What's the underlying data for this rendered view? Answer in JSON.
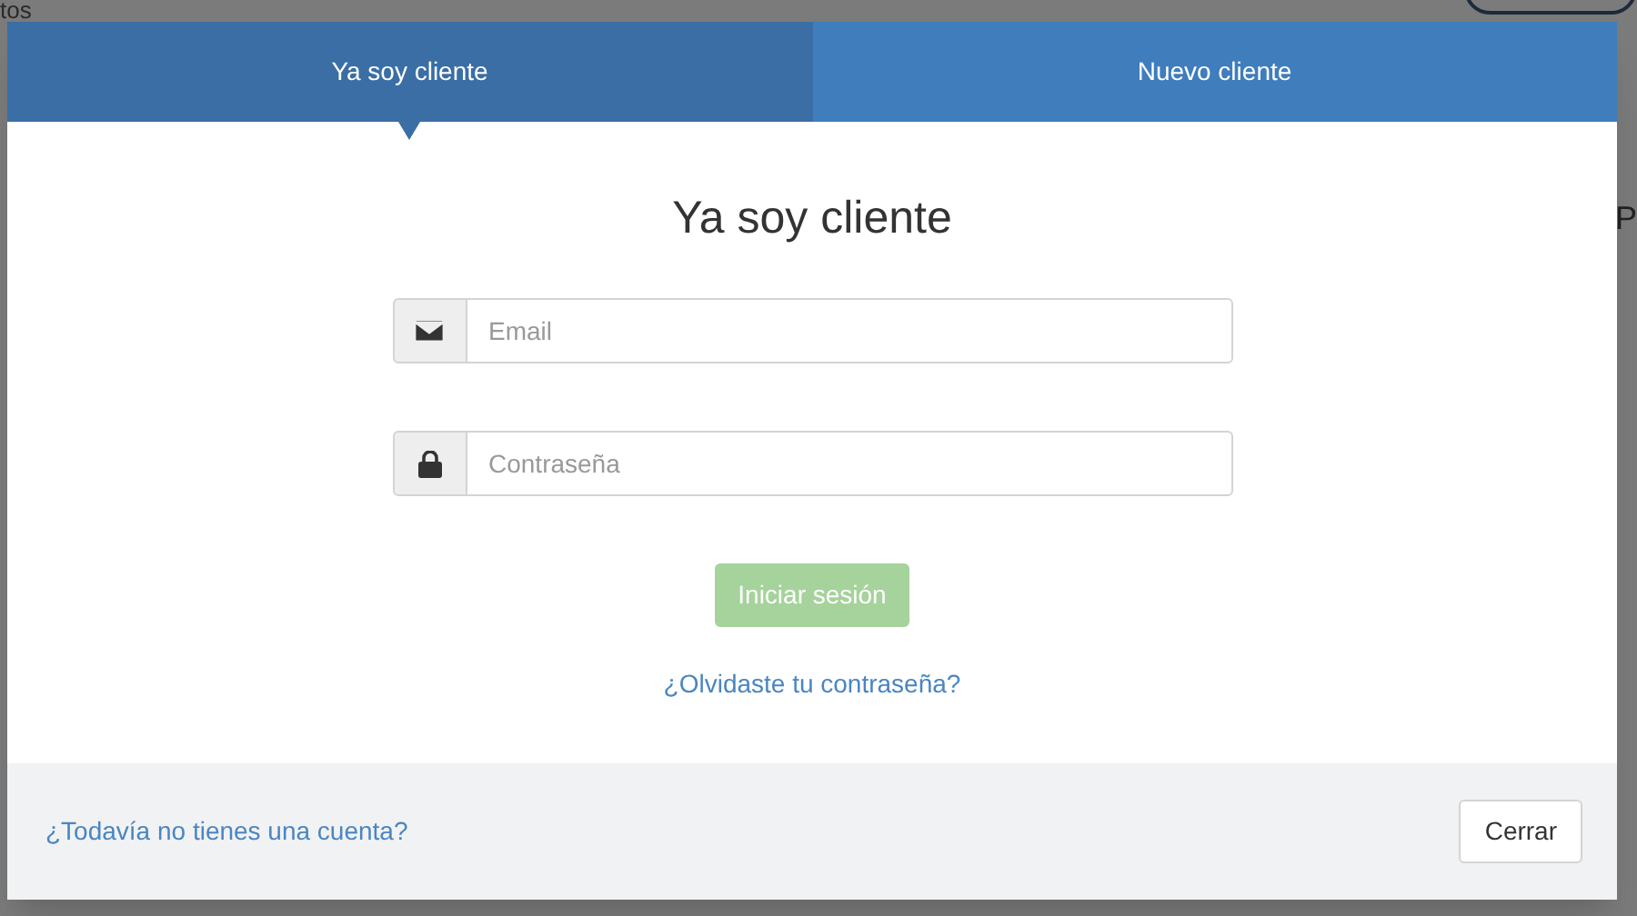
{
  "background": {
    "heading": "tos",
    "column_label": "P"
  },
  "tabs": [
    {
      "label": "Ya soy cliente",
      "selected": true
    },
    {
      "label": "Nuevo cliente",
      "selected": false
    }
  ],
  "form": {
    "title": "Ya soy cliente",
    "fields": [
      {
        "kind": "email",
        "placeholder": "Email"
      },
      {
        "kind": "password",
        "placeholder": "Contraseña"
      }
    ],
    "submit": {
      "label": "Iniciar sesión",
      "disabled": true
    },
    "forgot_link": "¿Olvidaste tu contraseña?"
  },
  "footer": {
    "signup_link": "¿Todavía no tienes una cuenta?",
    "close_button": "Cerrar"
  }
}
